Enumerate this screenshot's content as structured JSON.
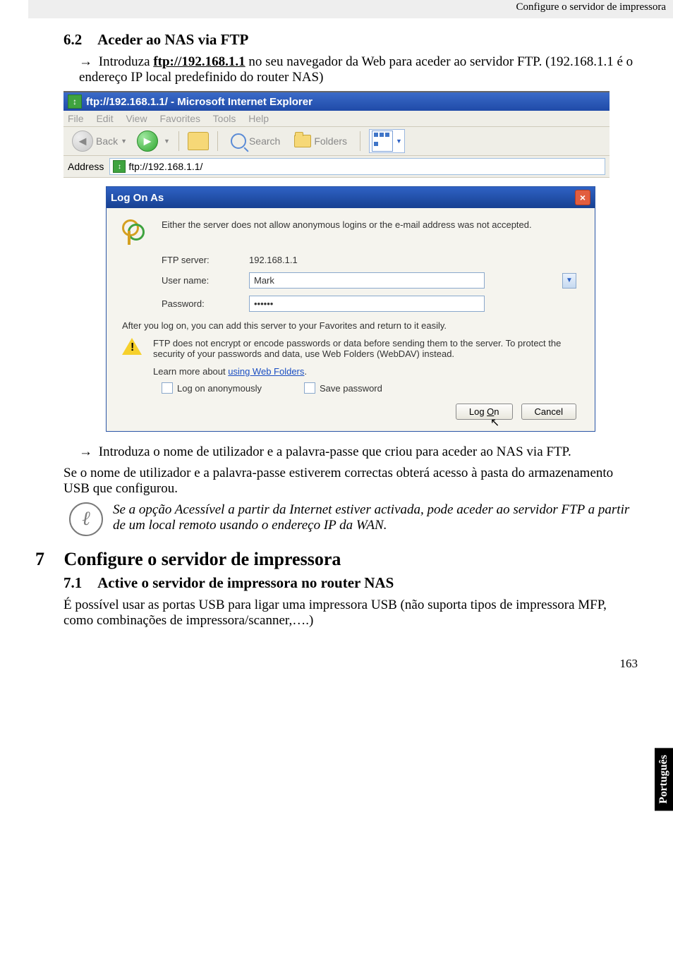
{
  "header_text": "Configure o servidor de impressora",
  "side_tab": "Português",
  "sec62": {
    "num": "6.2",
    "title": "Aceder ao NAS via FTP"
  },
  "line1a": "Introduza ",
  "line1_link": "ftp://192.168.1.1",
  "line1b": " no seu navegador da Web para aceder ao servidor FTP. (192.168.1.1 é o endereço IP local predefinido do router NAS)",
  "ie": {
    "title": "ftp://192.168.1.1/ - Microsoft Internet Explorer",
    "menu": {
      "file": "File",
      "edit": "Edit",
      "view": "View",
      "favorites": "Favorites",
      "tools": "Tools",
      "help": "Help"
    },
    "toolbar": {
      "back": "Back",
      "search": "Search",
      "folders": "Folders"
    },
    "addr_label": "Address",
    "addr_value": "ftp://192.168.1.1/"
  },
  "dialog": {
    "title": "Log On As",
    "msg": "Either the server does not allow anonymous logins or the e-mail address was not accepted.",
    "ftp_label": "FTP server:",
    "ftp_value": "192.168.1.1",
    "user_label": "User name:",
    "user_value": "Mark",
    "pass_label": "Password:",
    "pass_value": "••••••",
    "after": "After you log on, you can add this server to your Favorites and return to it easily.",
    "warn": "FTP does not encrypt or encode passwords or data before sending them to the server.  To protect the security of your passwords and data, use Web Folders (WebDAV) instead.",
    "learn_pre": "Learn more about ",
    "learn_link": "using Web Folders",
    "anon": "Log on anonymously",
    "save": "Save password",
    "logon_pre": "Log ",
    "logon_u": "O",
    "logon_post": "n",
    "cancel": "Cancel"
  },
  "line2": "Introduza o nome de utilizador e a palavra-passe que criou para aceder ao NAS via FTP.",
  "para1": "Se o nome de utilizador e a palavra-passe estiverem correctas obterá acesso à pasta do armazenamento USB que configurou.",
  "note": "Se a opção Acessível a partir da Internet estiver activada, pode aceder ao servidor FTP a partir de um local remoto usando o endereço IP da WAN.",
  "sec7": {
    "num": "7",
    "title": "Configure o servidor de impressora"
  },
  "sec71": {
    "num": "7.1",
    "title": "Active o servidor de impressora no router NAS"
  },
  "para2": "É possível usar as portas USB para ligar uma impressora USB (não suporta tipos de impressora MFP, como combinações de impressora/scanner,….)",
  "pagenum": "163"
}
